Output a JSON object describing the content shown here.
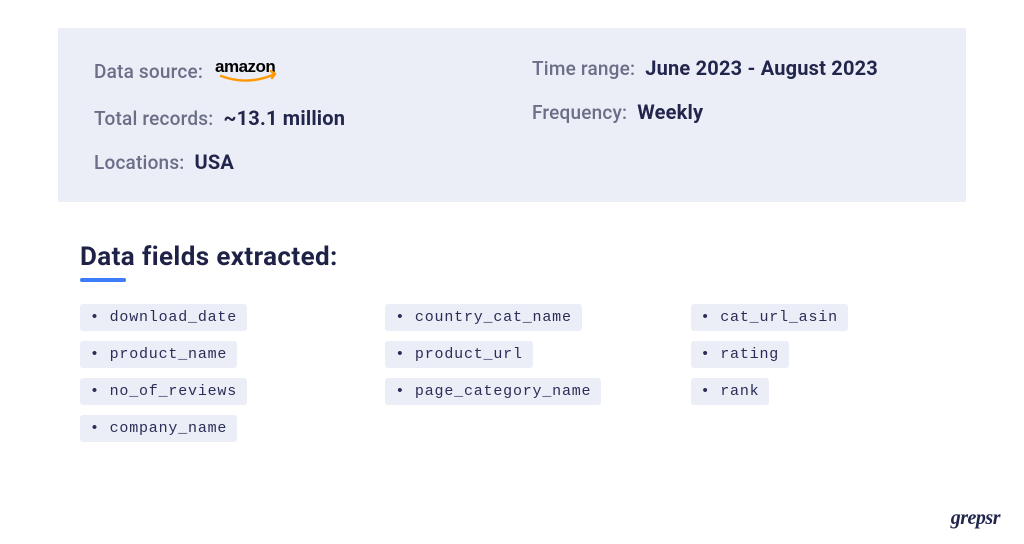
{
  "info": {
    "data_source_label": "Data source:",
    "data_source_value": "amazon",
    "total_records_label": "Total records:",
    "total_records_value": "~13.1 million",
    "locations_label": "Locations:",
    "locations_value": "USA",
    "time_range_label": "Time range:",
    "time_range_value": "June 2023 - August 2023",
    "frequency_label": "Frequency:",
    "frequency_value": "Weekly"
  },
  "section_title": "Data fields extracted:",
  "fields": {
    "col1": [
      "• download_date",
      "• product_name",
      "• no_of_reviews",
      "• company_name"
    ],
    "col2": [
      "• country_cat_name",
      "• product_url",
      "• page_category_name"
    ],
    "col3": [
      "• cat_url_asin",
      "• rating",
      "• rank"
    ]
  },
  "brand": "grepsr"
}
